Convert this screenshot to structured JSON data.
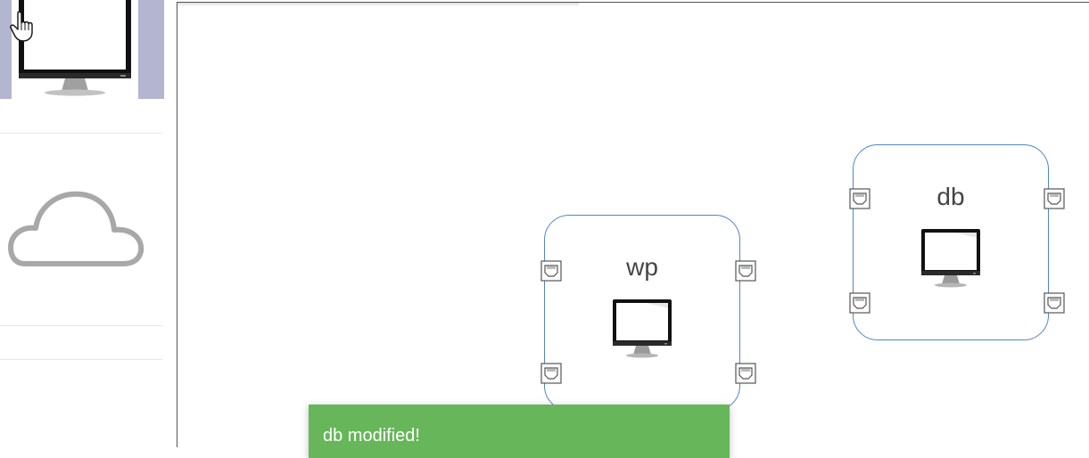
{
  "palette": {
    "items": [
      {
        "name": "monitor",
        "icon": "monitor-icon",
        "selected": true
      },
      {
        "name": "cloud",
        "icon": "cloud-icon",
        "selected": false
      }
    ],
    "selected_bg": "#b3b5d1"
  },
  "canvas": {
    "nodes": [
      {
        "label": "wp",
        "icon": "monitor-icon",
        "ports": 4
      },
      {
        "label": "db",
        "icon": "monitor-icon",
        "ports": 4
      }
    ],
    "node_border_color": "#4f86c6"
  },
  "toast": {
    "message": "db modified!",
    "color": "#67b65a"
  },
  "cursor": {
    "icon": "hand-cursor-icon"
  }
}
